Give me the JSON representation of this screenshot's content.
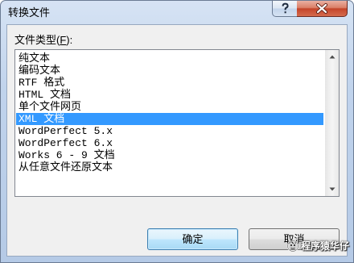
{
  "window": {
    "title": "转换文件",
    "help_icon": "help-icon",
    "close_icon": "close-icon"
  },
  "file_type": {
    "label_prefix": "文件类型(",
    "label_accel": "F",
    "label_suffix": "):"
  },
  "list": {
    "items": [
      "纯文本",
      "编码文本",
      "RTF 格式",
      "HTML 文档",
      "单个文件网页",
      "XML 文档",
      "WordPerfect 5.x",
      "WordPerfect 6.x",
      "Works 6 - 9 文档",
      "从任意文件还原文本"
    ],
    "selected_index": 5
  },
  "scrollbar": {
    "up_icon": "scroll-up-arrow-icon",
    "down_icon": "scroll-down-arrow-icon"
  },
  "buttons": {
    "ok_label": "确定",
    "cancel_label": "取消"
  },
  "watermark": {
    "text": "程序猿华仔",
    "logo_icon": "watermark-logo-icon"
  },
  "colors": {
    "selection": "#3399ff",
    "close_button": "#c4442a",
    "client_background": "#f0f0f0",
    "default_button_border": "#3c7fb1"
  }
}
